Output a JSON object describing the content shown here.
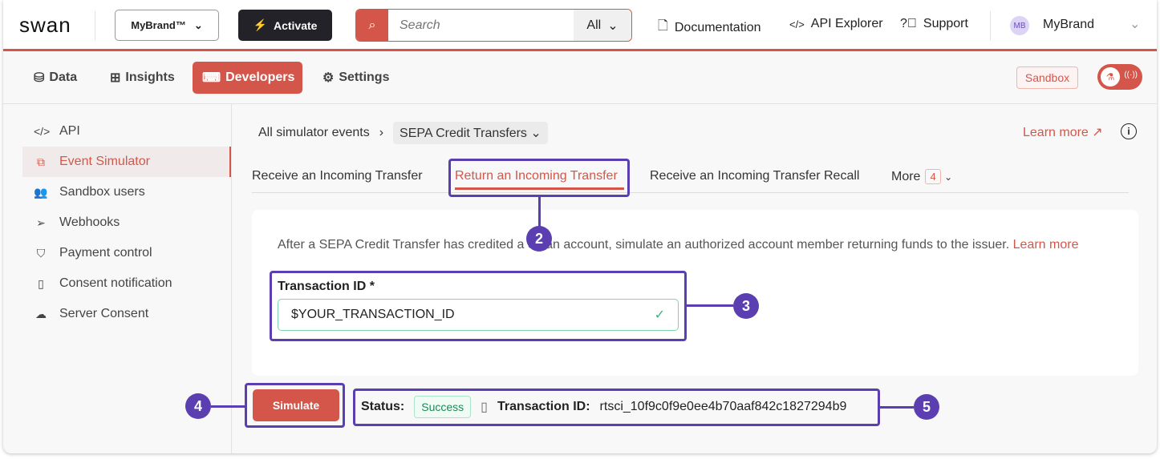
{
  "header": {
    "logo": "swan",
    "brand_selector": "MyBrand™",
    "activate": "Activate",
    "search_placeholder": "Search",
    "search_scope": "All",
    "links": [
      "Documentation",
      "API Explorer",
      "Support"
    ],
    "avatar_initials": "MB",
    "account": "MyBrand"
  },
  "nav": {
    "tabs": [
      "Data",
      "Insights",
      "Developers",
      "Settings"
    ],
    "active": "Developers",
    "sandbox": "Sandbox"
  },
  "sidebar": {
    "items": [
      "API",
      "Event Simulator",
      "Sandbox users",
      "Webhooks",
      "Payment control",
      "Consent notification",
      "Server Consent"
    ],
    "active": "Event Simulator"
  },
  "breadcrumb": {
    "root": "All simulator events",
    "current": "SEPA Credit Transfers"
  },
  "learn_more": "Learn more",
  "tabs": {
    "items": [
      "Receive an Incoming Transfer",
      "Return an Incoming Transfer",
      "Receive an Incoming Transfer Recall"
    ],
    "more": "More",
    "more_count": "4",
    "active": "Return an Incoming Transfer"
  },
  "form": {
    "description": "After a SEPA Credit Transfer has credited a Swan account, simulate an authorized account member returning funds to the issuer.",
    "description_link": "Learn more",
    "field_label": "Transaction ID *",
    "field_value": "$YOUR_TRANSACTION_ID"
  },
  "result": {
    "simulate": "Simulate",
    "status_label": "Status:",
    "status_value": "Success",
    "txn_label": "Transaction ID:",
    "txn_value": "rtsci_10f9c0f9e0ee4b70aaf842c1827294b9"
  },
  "annotations": [
    "2",
    "3",
    "4",
    "5"
  ],
  "colors": {
    "accent": "#d4564a",
    "annotation": "#5b3fb0",
    "success": "#1e8a52"
  }
}
